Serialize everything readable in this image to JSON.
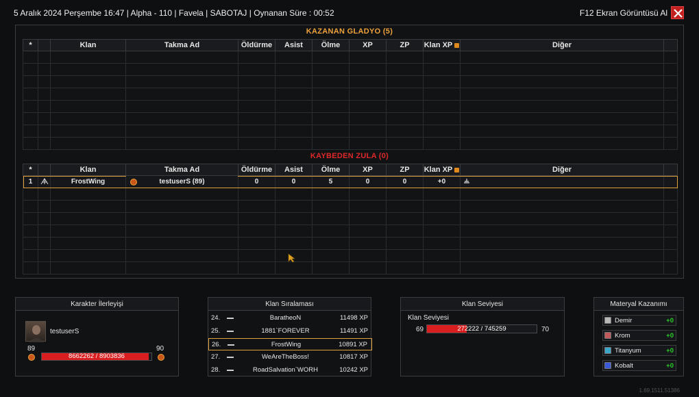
{
  "topbar": {
    "info": "5 Aralık 2024 Perşembe 16:47 | Alpha - 110 | Favela | SABOTAJ | Oynanan Süre : 00:52",
    "screenshot_label": "F12 Ekran Görüntüsü Al",
    "close_icon": "close-x-icon"
  },
  "scoreboard": {
    "columns": [
      "*",
      "",
      "Klan",
      "Takma Ad",
      "Öldürme",
      "Asist",
      "Ölme",
      "XP",
      "ZP",
      "Klan XP",
      "Diğer"
    ],
    "winning_team": {
      "title": "KAZANAN GLADYO (5)",
      "rows": []
    },
    "losing_team": {
      "title": "KAYBEDEN ZULA (0)",
      "rows": [
        {
          "index": "1",
          "clan_emblem": "clan-emblem-icon",
          "clan": "FrostWing",
          "rank_badge": "rank-badge-icon",
          "nickname": "testuserS (89)",
          "kills": "0",
          "assists": "0",
          "deaths": "5",
          "xp": "0",
          "zp": "0",
          "clan_xp": "+0",
          "other_icon": "emblem-icon"
        }
      ]
    },
    "title_colors": {
      "win": "#f0a23a",
      "lose": "#e02828"
    },
    "highlight_color": "#e0a23a"
  },
  "character_progress": {
    "title": "Karakter İlerleyişi",
    "name": "testuserS",
    "level_current": "89",
    "level_next": "90",
    "xp_text": "8662262 / 8903836",
    "progress_fraction": 0.973
  },
  "clan_ranking": {
    "title": "Klan Sıralaması",
    "rows": [
      {
        "pos": "24.",
        "name": "BaratheoN",
        "xp": "11498 XP",
        "highlight": false
      },
      {
        "pos": "25.",
        "name": "1881`FOREVER",
        "xp": "11491 XP",
        "highlight": false
      },
      {
        "pos": "26.",
        "name": "FrostWing",
        "xp": "10891 XP",
        "highlight": true
      },
      {
        "pos": "27.",
        "name": "WeAreTheBoss!",
        "xp": "10817 XP",
        "highlight": false
      },
      {
        "pos": "28.",
        "name": "RoadSalvation`WORH",
        "xp": "10242 XP",
        "highlight": false
      }
    ]
  },
  "clan_level": {
    "title": "Klan Seviyesi",
    "label": "Klan Seviyesi",
    "level_current": "69",
    "level_next": "70",
    "xp_text": "272222 / 745259",
    "progress_fraction": 0.365
  },
  "materials": {
    "title": "Materyal Kazanımı",
    "items": [
      {
        "name": "Demir",
        "value": "+0",
        "color": "#b8b8b8"
      },
      {
        "name": "Krom",
        "value": "+0",
        "color": "#c05a5a"
      },
      {
        "name": "Titanyum",
        "value": "+0",
        "color": "#3aa6c8"
      },
      {
        "name": "Kobalt",
        "value": "+0",
        "color": "#3a5ad8"
      }
    ]
  },
  "version": "1.69.1511.51386"
}
